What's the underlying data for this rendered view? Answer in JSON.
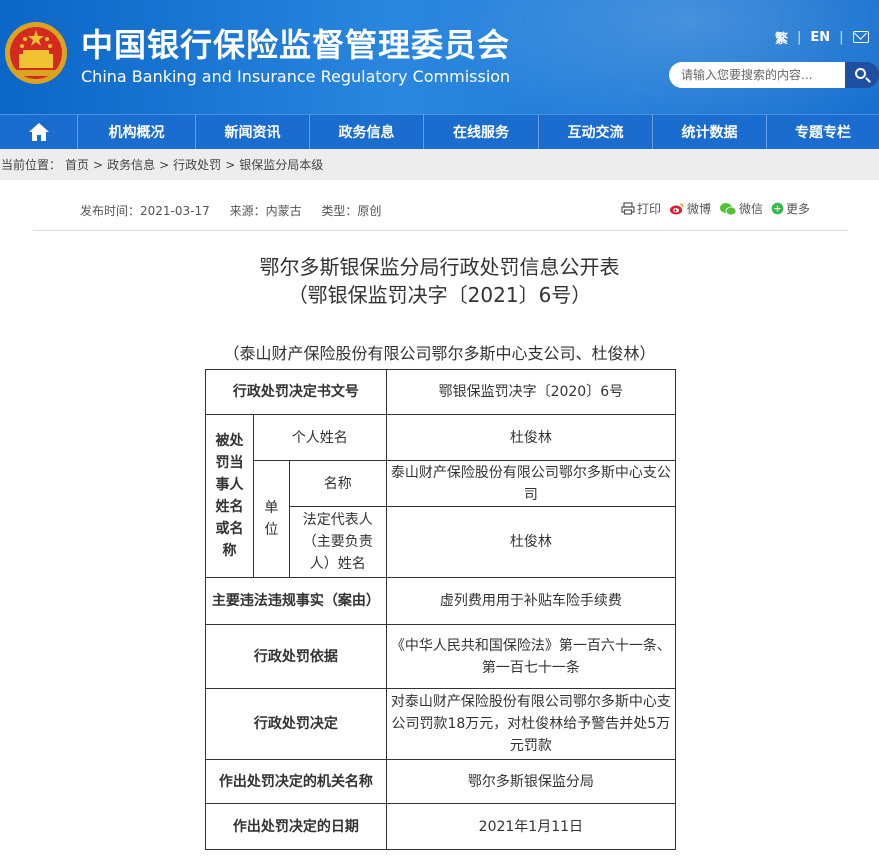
{
  "header": {
    "title_cn": "中国银行保险监督管理委员会",
    "title_en": "China Banking and Insurance Regulatory Commission",
    "lang_traditional": "繁",
    "lang_en": "EN",
    "search_placeholder": "请输入您要搜索的内容..."
  },
  "nav": {
    "items": [
      "机构概况",
      "新闻资讯",
      "政务信息",
      "在线服务",
      "互动交流",
      "统计数据",
      "专题专栏"
    ]
  },
  "breadcrumb": {
    "prefix": "当前位置：",
    "items": [
      "首页",
      "政务信息",
      "行政处罚",
      "银保监分局本级"
    ],
    "separator": ">"
  },
  "meta": {
    "publish_time": "发布时间：2021-03-17",
    "source": "来源：内蒙古",
    "type": "类型：原创"
  },
  "share": {
    "print": "打印",
    "weibo": "微博",
    "wechat": "微信",
    "more": "更多"
  },
  "document": {
    "title_line1": "鄂尔多斯银保监分局行政处罚信息公开表",
    "title_line2": "（鄂银保监罚决字〔2021〕6号）",
    "subtitle": "（泰山财产保险股份有限公司鄂尔多斯中心支公司、杜俊林）"
  },
  "table": {
    "doc_no_label": "行政处罚决定书文号",
    "doc_no_value": "鄂银保监罚决字〔2020〕6号",
    "party_label": "被处罚当事人姓名或名称",
    "individual_label": "个人姓名",
    "individual_value": "杜俊林",
    "unit_label": "单位",
    "unit_name_label": "名称",
    "unit_name_value": "泰山财产保险股份有限公司鄂尔多斯中心支公司",
    "legal_rep_label": "法定代表人（主要负责人）姓名",
    "legal_rep_value": "杜俊林",
    "facts_label": "主要违法违规事实（案由）",
    "facts_value": "虚列费用用于补贴车险手续费",
    "basis_label": "行政处罚依据",
    "basis_value": "《中华人民共和国保险法》第一百六十一条、第一百七十一条",
    "decision_label": "行政处罚决定",
    "decision_value": "对泰山财产保险股份有限公司鄂尔多斯中心支公司罚款18万元，对杜俊林给予警告并处5万元罚款",
    "authority_label": "作出处罚决定的机关名称",
    "authority_value": "鄂尔多斯银保监分局",
    "date_label": "作出处罚决定的日期",
    "date_value": "2021年1月11日"
  },
  "colors": {
    "header_blue": "#1770cf",
    "nav_blue": "#1a6ccf",
    "search_button": "#1f4fa0",
    "breadcrumb_bg": "#ededed"
  }
}
